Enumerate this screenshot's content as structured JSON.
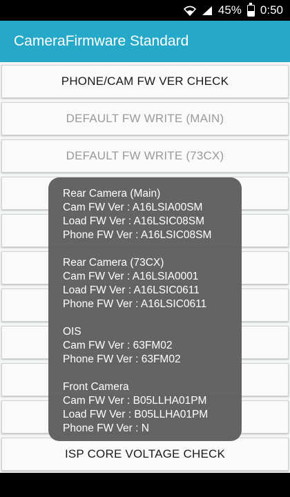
{
  "status_bar": {
    "battery_percent": "45%",
    "battery_level": 0.45,
    "time": "0:50",
    "icons": [
      "wifi-icon",
      "signal-icon",
      "battery-icon"
    ]
  },
  "app_bar": {
    "title": "CameraFirmware Standard",
    "color": "#26a9c9"
  },
  "buttons": [
    {
      "label": "PHONE/CAM FW VER CHECK",
      "enabled": true
    },
    {
      "label": "DEFAULT FW WRITE (MAIN)",
      "enabled": false
    },
    {
      "label": "DEFAULT FW WRITE (73CX)",
      "enabled": false
    },
    {
      "label": "",
      "enabled": true
    },
    {
      "label": "",
      "enabled": true
    },
    {
      "label": "",
      "enabled": true
    },
    {
      "label": "",
      "enabled": true
    },
    {
      "label": "",
      "enabled": true
    },
    {
      "label": "",
      "enabled": true
    },
    {
      "label": "",
      "enabled": true
    },
    {
      "label": "ISP CORE VOLTAGE CHECK",
      "enabled": true
    }
  ],
  "popup": {
    "groups": [
      {
        "title": "Rear Camera (Main)",
        "lines": [
          "Cam FW Ver : A16LSIA00SM",
          "Load FW Ver : A16LSIC08SM",
          "Phone FW Ver : A16LSIC08SM"
        ]
      },
      {
        "title": "Rear Camera (73CX)",
        "lines": [
          "Cam FW Ver : A16LSIA0001",
          "Load FW Ver : A16LSIC0611",
          "Phone FW Ver : A16LSIC0611"
        ]
      },
      {
        "title": "OIS",
        "lines": [
          "Cam FW Ver : 63FM02",
          "Phone FW Ver : 63FM02"
        ]
      },
      {
        "title": "Front Camera",
        "lines": [
          "Cam FW Ver : B05LLHA01PM",
          "Load FW Ver : B05LLHA01PM",
          "Phone FW Ver : N"
        ]
      }
    ]
  }
}
